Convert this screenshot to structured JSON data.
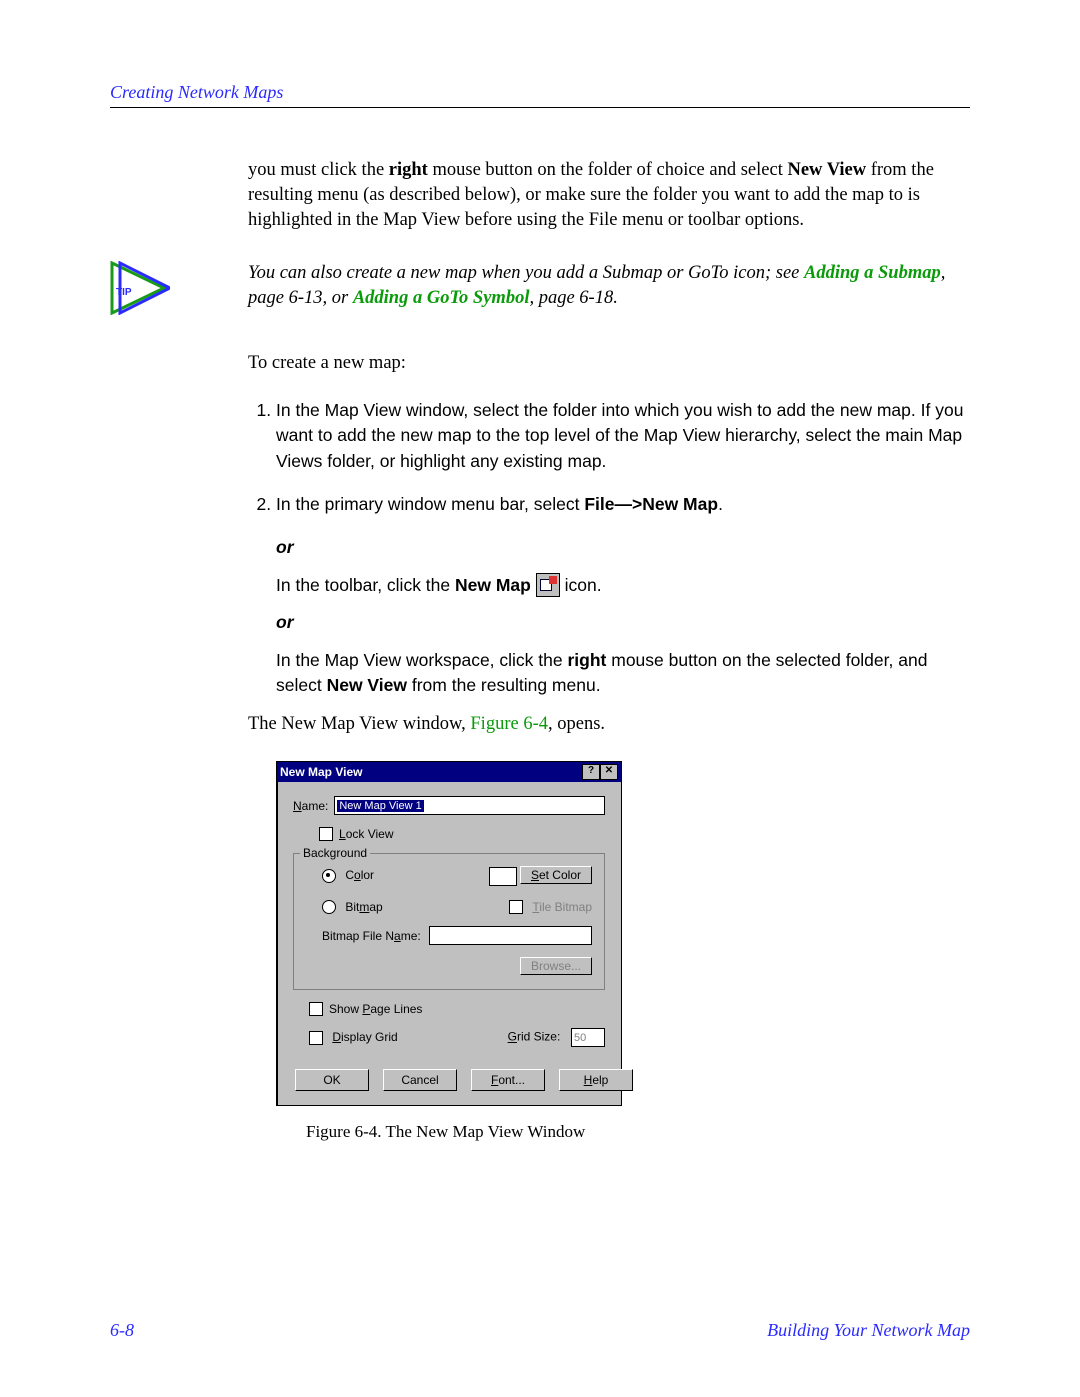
{
  "header": {
    "title": "Creating Network Maps"
  },
  "intro": {
    "pre": "you must click the ",
    "right": "right",
    "mid1": " mouse button on the folder of choice and select ",
    "newview": "New View",
    "post": " from the resulting menu (as described below), or make sure the folder you want to add the map to is highlighted in the Map View before using the File menu or toolbar options."
  },
  "tip": {
    "label": "TIP",
    "t1": "You can also create a new map when you add a Submap or GoTo icon; see ",
    "link1": "Adding a Submap",
    "t2": ", page 6-13, or ",
    "link2": "Adding a GoTo Symbol",
    "t3": ", page 6-18."
  },
  "lead": "To create a new map:",
  "steps": {
    "s1": "In the Map View window, select the folder into which you wish to add the new map. If you want to add the new map to the top level of the Map View hierarchy, select the main Map Views folder, or highlight any existing map.",
    "s2a": "In the primary window menu bar, select ",
    "s2b": "File—>New Map",
    "s2c": ".",
    "or": "or",
    "s2d_a": "In the toolbar, click the ",
    "s2d_b": "New Map",
    "s2d_c": "  icon.",
    "s2e_a": "In the Map View workspace, click the ",
    "s2e_b": "right",
    "s2e_c": " mouse button on the selected folder, and select ",
    "s2e_d": "New View",
    "s2e_e": " from the resulting menu."
  },
  "after": {
    "a": "The New Map View window, ",
    "figref": "Figure 6-4",
    "b": ", opens."
  },
  "dialog": {
    "title": "New Map View",
    "help_btn": "?",
    "close_btn": "✕",
    "name_lbl_pre": "N",
    "name_lbl_post": "ame:",
    "name_val": "New Map View 1",
    "lock_pre": "L",
    "lock_post": "ock View",
    "bg_legend": "Background",
    "color_pre": "C",
    "color_u": "o",
    "color_post": "lor",
    "setcolor_pre": "S",
    "setcolor_post": "et Color",
    "bitmap_pre": "Bit",
    "bitmap_u": "m",
    "bitmap_post": "ap",
    "tilebmp_pre": "T",
    "tilebmp_post": "ile Bitmap",
    "bfn_pre": "Bitmap File N",
    "bfn_u": "a",
    "bfn_post": "me:",
    "browse": "Browse...",
    "spl_pre": "Show ",
    "spl_u": "P",
    "spl_post": "age Lines",
    "dg_pre": "D",
    "dg_post": "isplay Grid",
    "gs_pre": "G",
    "gs_post": "rid Size:",
    "gs_val": "50",
    "ok": "OK",
    "cancel": "Cancel",
    "font_pre": "F",
    "font_post": "ont...",
    "helpb_pre": "H",
    "helpb_post": "elp"
  },
  "caption": "Figure 6-4.  The New Map View Window",
  "footer": {
    "page": "6-8",
    "section": "Building Your Network Map"
  }
}
